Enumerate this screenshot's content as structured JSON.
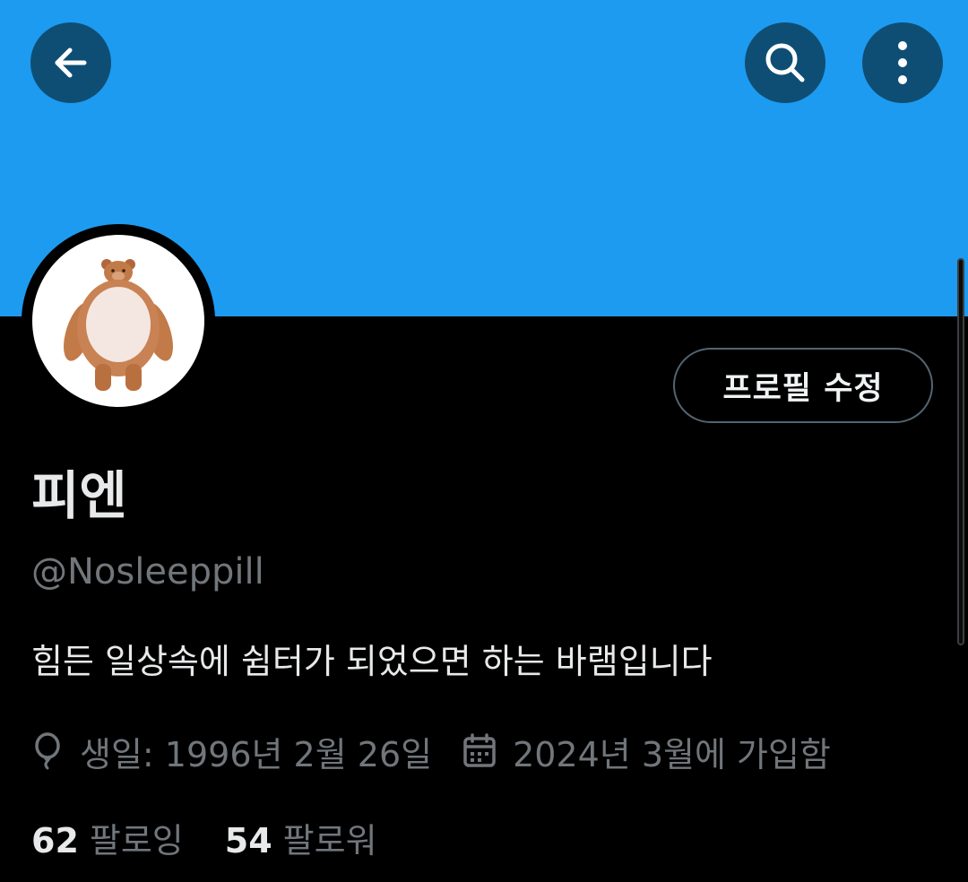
{
  "header": {
    "back_icon": "arrow-left-icon",
    "search_icon": "search-icon",
    "more_icon": "more-vertical-icon",
    "banner_color": "#1d9bf0",
    "button_color": "#0f4e74"
  },
  "profile": {
    "avatar_description": "plush bear avatar",
    "edit_button_label": "프로필 수정",
    "display_name": "피엔",
    "handle": "@Nosleeppill",
    "bio": "힘든 일상속에 쉼터가 되었으면 하는 바램입니다",
    "birthday": "생일: 1996년 2월 26일",
    "birthday_icon": "balloon-icon",
    "joined": "2024년 3월에 가입함",
    "joined_icon": "calendar-icon",
    "following_count": "62",
    "following_label": "팔로잉",
    "followers_count": "54",
    "followers_label": "팔로워"
  },
  "colors": {
    "background": "#000000",
    "primary_text": "#e7e9ea",
    "secondary_text": "#71767b",
    "button_border": "#536471"
  }
}
